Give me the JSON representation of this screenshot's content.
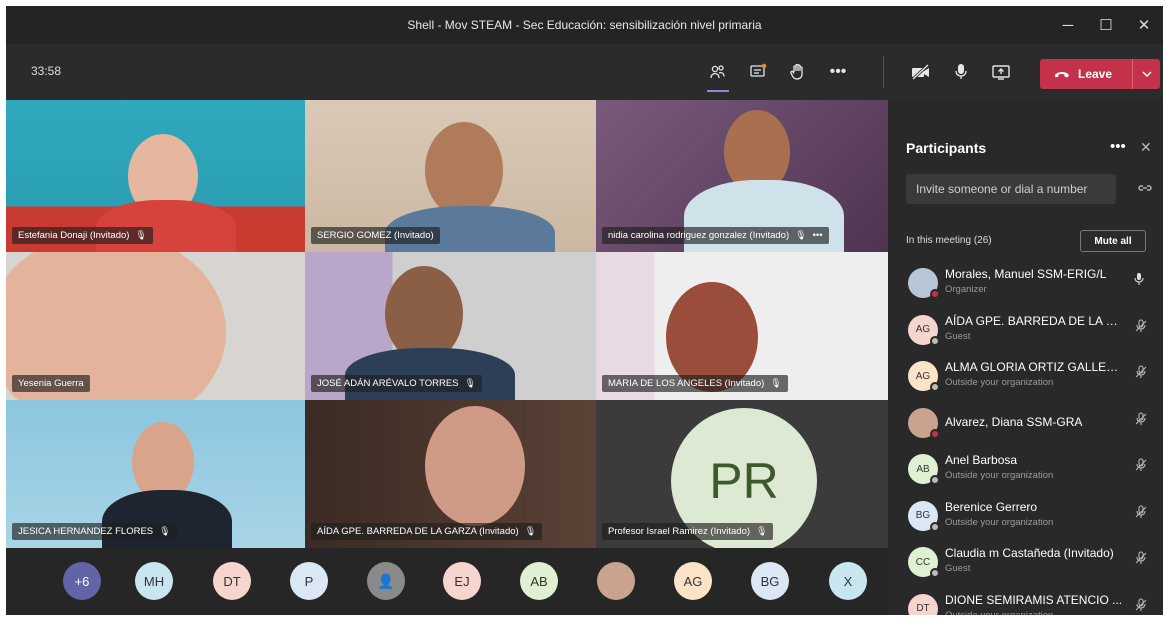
{
  "window": {
    "title": "Shell - Mov STEAM - Sec Educación: sensibilización nivel primaria",
    "minimize": "─",
    "maximize": "☐",
    "close": "✕"
  },
  "toolbar": {
    "timer": "33:58",
    "leave_label": "Leave",
    "icons": [
      "people-icon",
      "chat-icon",
      "raise-hand-icon",
      "more-icon",
      "camera-off-icon",
      "mic-icon",
      "share-screen-icon"
    ]
  },
  "videos": [
    {
      "name": "Estefania Donaji (Invitado)"
    },
    {
      "name": "SERGIO GOMEZ (Invitado)"
    },
    {
      "name": "nidia carolina rodriguez gonzalez (Invitado)"
    },
    {
      "name": "Yesenia Guerra"
    },
    {
      "name": "JOSÉ ADÁN ARÉVALO TORRES"
    },
    {
      "name": "MARIA DE LOS ANGELES (Invitado)"
    },
    {
      "name": "JESICA HERNANDEZ FLORES"
    },
    {
      "name": "AÍDA GPE. BARREDA DE LA GARZA (Invitado)"
    },
    {
      "name": "Profesor Israel Ramirez (Invitado)",
      "initials": "PR"
    }
  ],
  "bottom_avatars": [
    {
      "label": "+6",
      "color": "#6264a7"
    },
    {
      "label": "MH",
      "color": "#c8e6ef"
    },
    {
      "label": "DT",
      "color": "#f6d5cf"
    },
    {
      "label": "P",
      "color": "#dbe7f4"
    },
    {
      "label": "",
      "color": "#8a8a8a"
    },
    {
      "label": "EJ",
      "color": "#f6d5cf"
    },
    {
      "label": "AB",
      "color": "#dff0d3"
    },
    {
      "label": "",
      "color": "#c9a38d"
    },
    {
      "label": "AG",
      "color": "#fbe3c8"
    },
    {
      "label": "BG",
      "color": "#dbe7f4"
    },
    {
      "label": "X",
      "color": "#c8e6ef"
    }
  ],
  "panel": {
    "title": "Participants",
    "more": "•••",
    "close": "✕",
    "invite_placeholder": "Invite someone or dial a number",
    "in_meeting": "In this meeting (26)",
    "mute_all": "Mute all",
    "participants": [
      {
        "name": "Morales, Manuel SSM-ERIG/L",
        "role": "Organizer",
        "initials": "",
        "color": "#b8c7d8",
        "dot": "#c4314b",
        "mic": "on"
      },
      {
        "name": "AÍDA GPE. BARREDA DE LA G...",
        "role": "Guest",
        "initials": "AG",
        "color": "#f6d5cf",
        "dot": "#bbbbbb",
        "mic": "muted"
      },
      {
        "name": "ALMA GLORIA ORTIZ GALLEG...",
        "role": "Outside your organization",
        "initials": "AG",
        "color": "#fbe3c8",
        "dot": "#bbbbbb",
        "mic": "muted"
      },
      {
        "name": "Alvarez, Diana SSM-GRA",
        "role": "",
        "initials": "",
        "color": "#c9a38d",
        "dot": "#c4314b",
        "mic": "muted"
      },
      {
        "name": "Anel Barbosa",
        "role": "Outside your organization",
        "initials": "AB",
        "color": "#dff0d3",
        "dot": "#bbbbbb",
        "mic": "muted"
      },
      {
        "name": "Berenice Gerrero",
        "role": "Outside your organization",
        "initials": "BG",
        "color": "#dbe7f4",
        "dot": "#bbbbbb",
        "mic": "muted"
      },
      {
        "name": "Claudia m Castañeda (Invitado)",
        "role": "Guest",
        "initials": "CC",
        "color": "#dff0d3",
        "dot": "#bbbbbb",
        "mic": "muted"
      },
      {
        "name": "DIONE SEMIRAMIS ATENCIO ...",
        "role": "Outside your organization",
        "initials": "DT",
        "color": "#f6d5cf",
        "dot": "#bbbbbb",
        "mic": "muted"
      }
    ]
  }
}
